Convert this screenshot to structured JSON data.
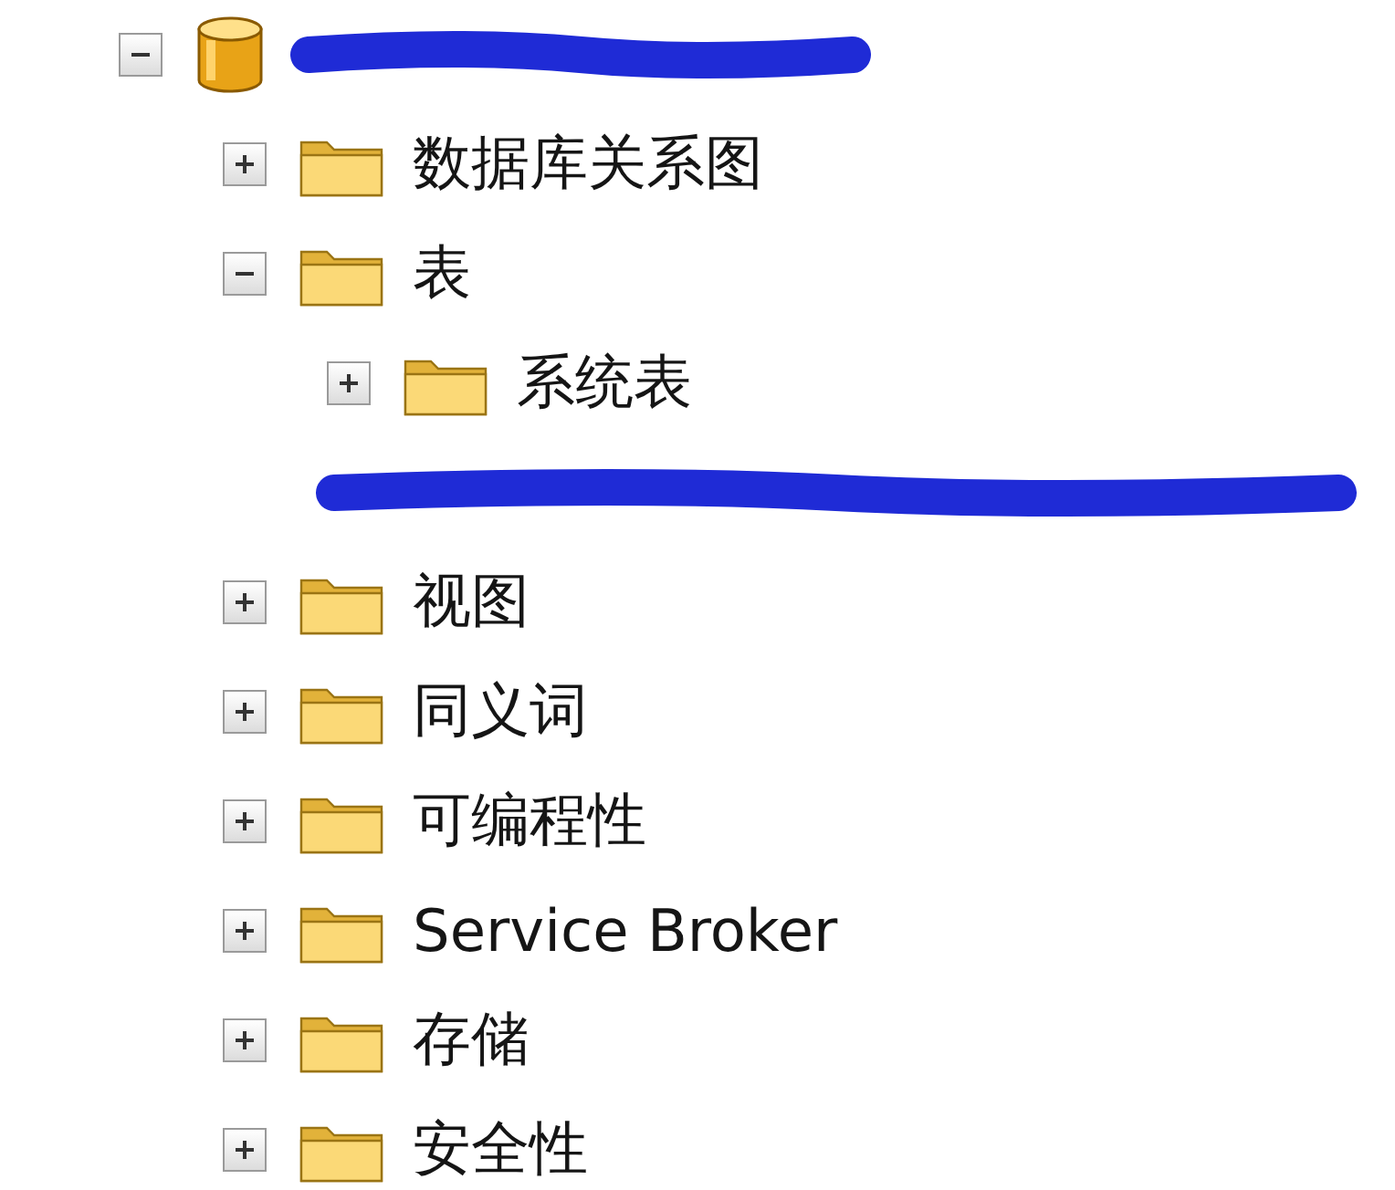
{
  "tree": [
    {
      "kind": "database",
      "expanded": true,
      "redacted": true,
      "children": [
        {
          "kind": "folder",
          "label": "数据库关系图",
          "expanded": false
        },
        {
          "kind": "folder",
          "label": "表",
          "expanded": true,
          "children": [
            {
              "kind": "folder",
              "label": "系统表",
              "expanded": false
            },
            {
              "kind": "table",
              "redacted": true
            }
          ]
        },
        {
          "kind": "folder",
          "label": "视图",
          "expanded": false
        },
        {
          "kind": "folder",
          "label": "同义词",
          "expanded": false
        },
        {
          "kind": "folder",
          "label": "可编程性",
          "expanded": false
        },
        {
          "kind": "folder",
          "label": "Service Broker",
          "expanded": false
        },
        {
          "kind": "folder",
          "label": "存储",
          "expanded": false
        },
        {
          "kind": "folder",
          "label": "安全性",
          "expanded": false
        }
      ]
    }
  ]
}
